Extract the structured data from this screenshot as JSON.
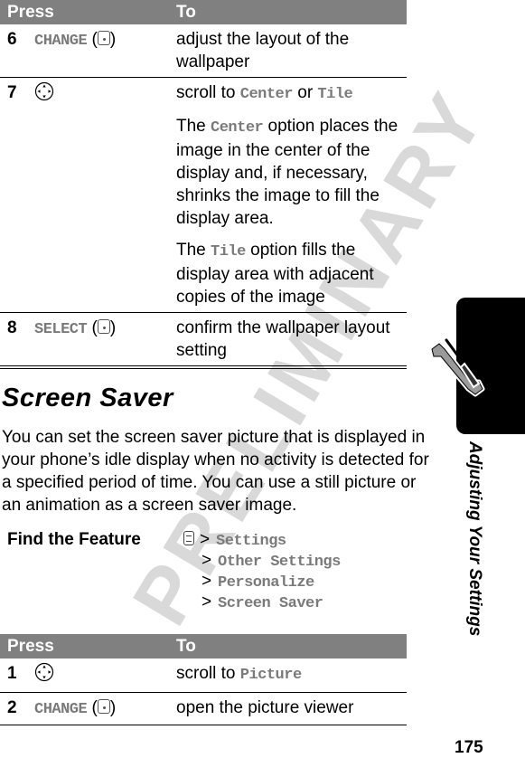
{
  "watermark": "PRELIMINARY",
  "table1": {
    "headers": {
      "press": "Press",
      "to": "To"
    },
    "rows": [
      {
        "num": "6",
        "press_key": "CHANGE",
        "press_icon": "select-key-icon",
        "to_lines": [
          "adjust the layout of the wallpaper"
        ]
      },
      {
        "num": "7",
        "press_key": "",
        "press_icon": "nav-key-icon",
        "to": {
          "line1_prefix": "scroll to ",
          "line1_opt1": "Center",
          "line1_mid": " or ",
          "line1_opt2": "Tile",
          "para2_prefix": "The ",
          "para2_opt": "Center",
          "para2_rest": " option places the image in the center of the display and, if necessary, shrinks the image to fill the display area.",
          "para3_prefix": "The ",
          "para3_opt": "Tile",
          "para3_rest": " option fills the display area with adjacent copies of the image"
        }
      },
      {
        "num": "8",
        "press_key": "SELECT",
        "press_icon": "select-key-icon",
        "to_lines": [
          "confirm the wallpaper layout setting"
        ]
      }
    ]
  },
  "section": {
    "title": "Screen Saver",
    "body": "You can set the screen saver picture that is displayed in your phone’s idle display when no activity is detected for a specified period of time. You can use a still picture or an animation as a screen saver image."
  },
  "find_feature": {
    "label": "Find the Feature",
    "icon": "menu-key-icon",
    "separator": ">",
    "path": [
      "Settings",
      "Other Settings",
      "Personalize",
      "Screen Saver"
    ]
  },
  "table2": {
    "headers": {
      "press": "Press",
      "to": "To"
    },
    "rows": [
      {
        "num": "1",
        "press_key": "",
        "press_icon": "nav-key-icon",
        "to_prefix": "scroll to ",
        "to_opt": "Picture"
      },
      {
        "num": "2",
        "press_key": "CHANGE",
        "press_icon": "select-key-icon",
        "to_text": "open the picture viewer"
      }
    ]
  },
  "side_tab": {
    "icon": "wrench-screwdriver-icon",
    "title": "Adjusting Your Settings"
  },
  "page_number": "175"
}
